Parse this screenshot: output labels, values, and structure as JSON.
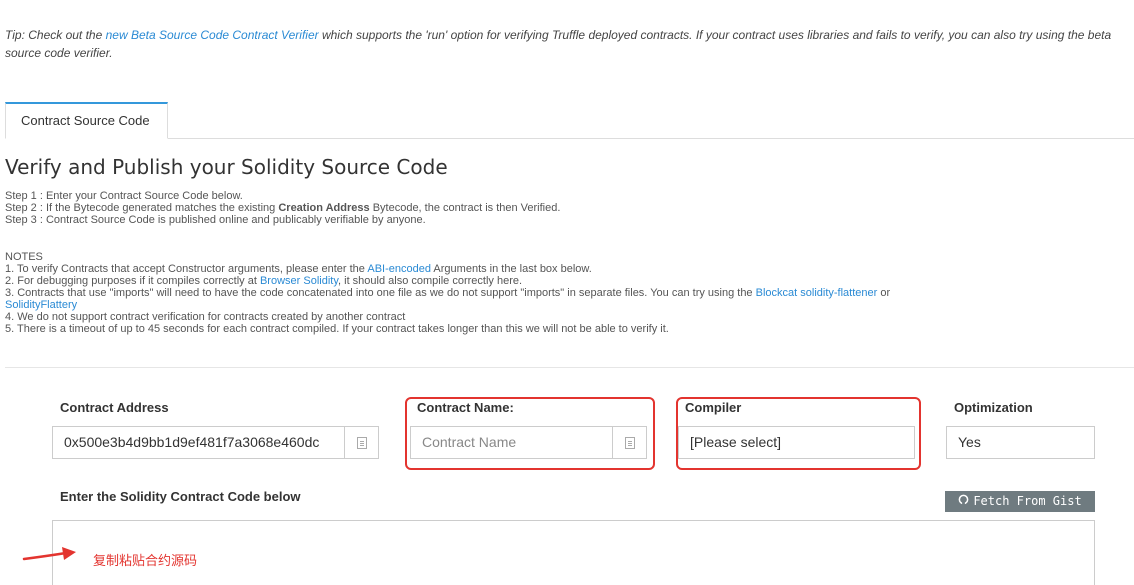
{
  "tip": {
    "prefix": "Tip: Check out the ",
    "link": "new Beta Source Code Contract Verifier",
    "suffix": " which supports the 'run' option for verifying Truffle deployed contracts. If your contract uses libraries and fails to verify, you can also try using the beta source code verifier."
  },
  "tabs": [
    {
      "label": "Contract Source Code"
    }
  ],
  "title": "Verify and Publish your Solidity Source Code",
  "steps": {
    "step1": "Step 1 : Enter your Contract Source Code below.",
    "step2_prefix": "Step 2 : If the Bytecode generated matches the existing ",
    "step2_bold": "Creation Address",
    "step2_suffix": " Bytecode, the contract is then Verified.",
    "step3": "Step 3 : Contract Source Code is published online and publicably verifiable by anyone."
  },
  "notes": {
    "heading": "NOTES",
    "n1_prefix": "1. To verify Contracts that accept Constructor arguments, please enter the ",
    "n1_link": "ABI-encoded",
    "n1_suffix": " Arguments in the last box below.",
    "n2_prefix": "2. For debugging purposes if it compiles correctly at ",
    "n2_link": "Browser Solidity",
    "n2_suffix": ", it should also compile correctly here.",
    "n3_prefix": "3. Contracts that use \"imports\" will need to have the code concatenated into one file as we do not support \"imports\" in separate files. You can try using the ",
    "n3_link1": "Blockcat solidity-flattener",
    "n3_mid": " or ",
    "n3_link2": "SolidityFlattery",
    "n4": "4. We do not support contract verification for contracts created by another contract",
    "n5": "5. There is a timeout of up to 45 seconds for each contract compiled. If your contract takes longer than this we will not be able to verify it."
  },
  "form": {
    "address_label": "Contract Address",
    "address_value": "0x500e3b4d9bb1d9ef481f7a3068e460dc",
    "name_label": "Contract Name:",
    "name_placeholder": "Contract Name",
    "compiler_label": "Compiler",
    "compiler_value": "[Please select]",
    "optimization_label": "Optimization",
    "optimization_value": "Yes",
    "code_label": "Enter the Solidity Contract Code below",
    "fetch_gist": "Fetch From Gist"
  },
  "annotation": {
    "text": "复制粘贴合约源码",
    "color": "#e3342f"
  },
  "colors": {
    "link": "#2a8ad4",
    "tab_accent": "#3498db",
    "highlight": "#e3342f",
    "gist_button": "#6f7b80"
  }
}
